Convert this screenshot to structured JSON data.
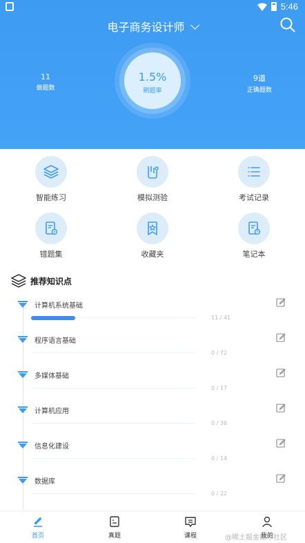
{
  "status_bar": {
    "time": "5:46"
  },
  "header": {
    "title": "电子商务设计师",
    "center": {
      "value": "1.5%",
      "label": "刷题率"
    },
    "left_stat": {
      "value": "11",
      "label": "做题数"
    },
    "right_stat": {
      "value": "9道",
      "label": "正确题数"
    }
  },
  "grid": [
    {
      "label": "智能练习",
      "icon": "layers-icon"
    },
    {
      "label": "模拟测验",
      "icon": "flask-icon"
    },
    {
      "label": "考试记录",
      "icon": "list-icon"
    },
    {
      "label": "错题集",
      "icon": "error-book-icon"
    },
    {
      "label": "收藏夹",
      "icon": "bookmark-star-icon"
    },
    {
      "label": "笔记本",
      "icon": "notebook-icon"
    }
  ],
  "section": {
    "title": "推荐知识点"
  },
  "knowledge_points": [
    {
      "name": "计算机系统基础",
      "count": "11 / 41",
      "progress": 0.27
    },
    {
      "name": "程序语言基础",
      "count": "0 / 72",
      "progress": 0
    },
    {
      "name": "多媒体基础",
      "count": "0 / 17",
      "progress": 0
    },
    {
      "name": "计算机应用",
      "count": "0 / 38",
      "progress": 0
    },
    {
      "name": "信息化建设",
      "count": "0 / 14",
      "progress": 0
    },
    {
      "name": "数据库",
      "count": "0 / 22",
      "progress": 0
    }
  ],
  "bottom_nav": [
    {
      "label": "首页",
      "active": true
    },
    {
      "label": "真题",
      "active": false
    },
    {
      "label": "课程",
      "active": false
    },
    {
      "label": "我的",
      "active": false
    }
  ],
  "watermark": "@稀土掘金技术社区",
  "colors": {
    "primary": "#3d9bf2",
    "icon_bg": "#dcecf9",
    "progress": "#3d8ee8"
  }
}
